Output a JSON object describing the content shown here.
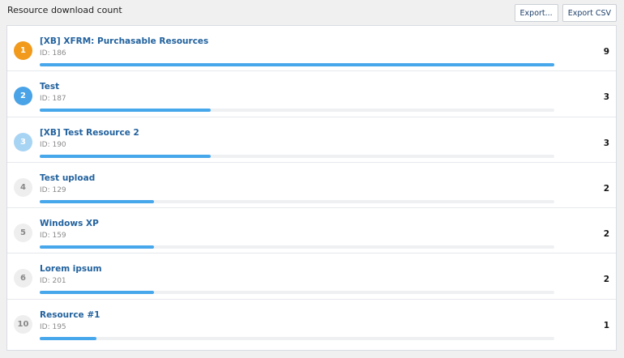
{
  "header": {
    "title": "Resource download count",
    "export_label": "Export...",
    "export_csv_label": "Export CSV"
  },
  "max_count": 9,
  "rows": [
    {
      "rank": "1",
      "title": "[XB] XFRM: Purchasable Resources",
      "id": "ID: 186",
      "count": "9",
      "fraction": 1.0,
      "rank_style": "r1"
    },
    {
      "rank": "2",
      "title": "Test",
      "id": "ID: 187",
      "count": "3",
      "fraction": 0.333,
      "rank_style": "r2"
    },
    {
      "rank": "3",
      "title": "[XB] Test Resource 2",
      "id": "ID: 190",
      "count": "3",
      "fraction": 0.333,
      "rank_style": "r3"
    },
    {
      "rank": "4",
      "title": "Test upload",
      "id": "ID: 129",
      "count": "2",
      "fraction": 0.222,
      "rank_style": "rn"
    },
    {
      "rank": "5",
      "title": "Windows XP",
      "id": "ID: 159",
      "count": "2",
      "fraction": 0.222,
      "rank_style": "rn"
    },
    {
      "rank": "6",
      "title": "Lorem ipsum",
      "id": "ID: 201",
      "count": "2",
      "fraction": 0.222,
      "rank_style": "rn"
    },
    {
      "rank": "10",
      "title": "Resource #1",
      "id": "ID: 195",
      "count": "1",
      "fraction": 0.111,
      "rank_style": "rn"
    }
  ],
  "colors": {
    "rank_1": "#f19a1b",
    "rank_2": "#49a3e6",
    "rank_3": "#a8d4f4",
    "bar": "#47a7eb",
    "link": "#22629e"
  }
}
